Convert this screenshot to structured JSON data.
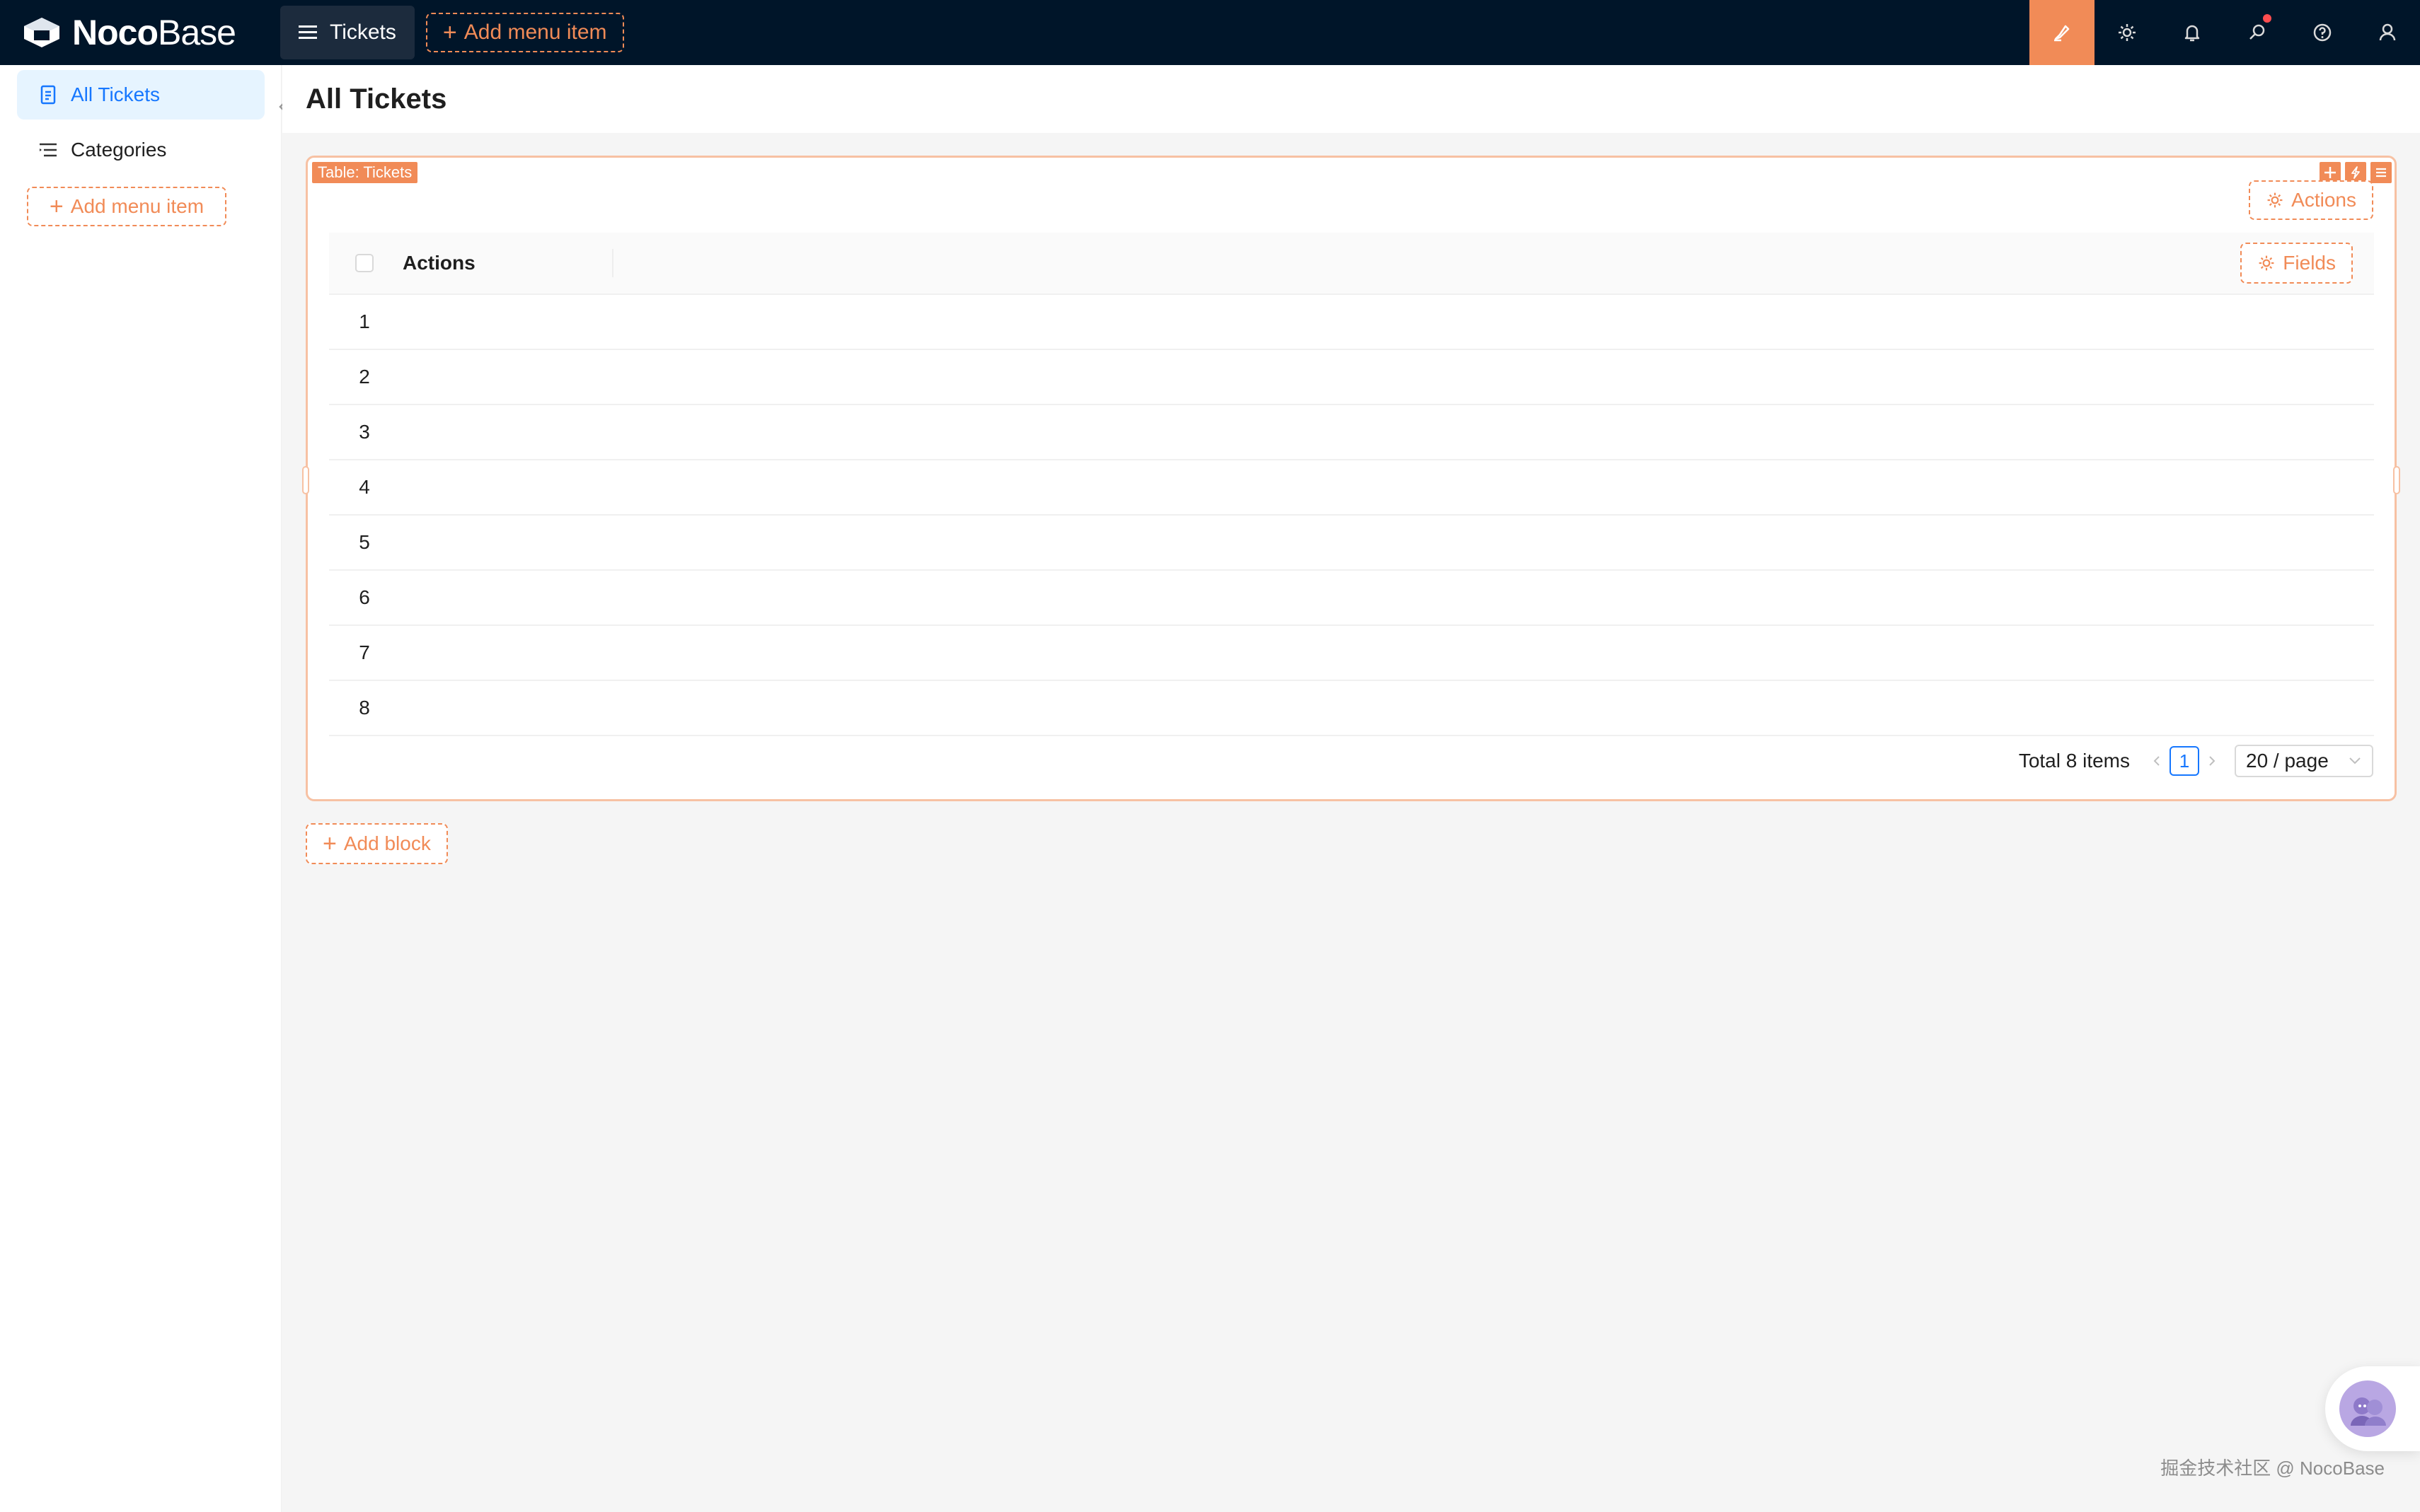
{
  "brand": {
    "name_bold": "Noco",
    "name_light": "Base"
  },
  "top_menu": {
    "current": "Tickets",
    "add_menu_item": "Add menu item"
  },
  "top_right_icons": [
    "ui-editor-icon",
    "settings-icon",
    "bell-icon",
    "search-icon",
    "help-icon",
    "user-icon"
  ],
  "sidebar": {
    "items": [
      {
        "label": "All Tickets",
        "icon": "file-icon",
        "active": true
      },
      {
        "label": "Categories",
        "icon": "list-icon",
        "active": false
      }
    ],
    "add_menu_item": "Add menu item"
  },
  "page": {
    "title": "All Tickets"
  },
  "block": {
    "tag": "Table: Tickets",
    "actions_button": "Actions",
    "table": {
      "columns": [
        "Actions"
      ],
      "fields_button": "Fields",
      "rows": [
        "1",
        "2",
        "3",
        "4",
        "5",
        "6",
        "7",
        "8"
      ]
    },
    "pagination": {
      "total": "Total 8 items",
      "current_page": "1",
      "page_size": "20 / page"
    }
  },
  "add_block": "Add block",
  "watermark": "掘金技术社区 @ NocoBase",
  "colors": {
    "topbar": "#001529",
    "accent": "#f18b57",
    "active_blue": "#1677ff",
    "active_bg": "#e6f4ff"
  }
}
